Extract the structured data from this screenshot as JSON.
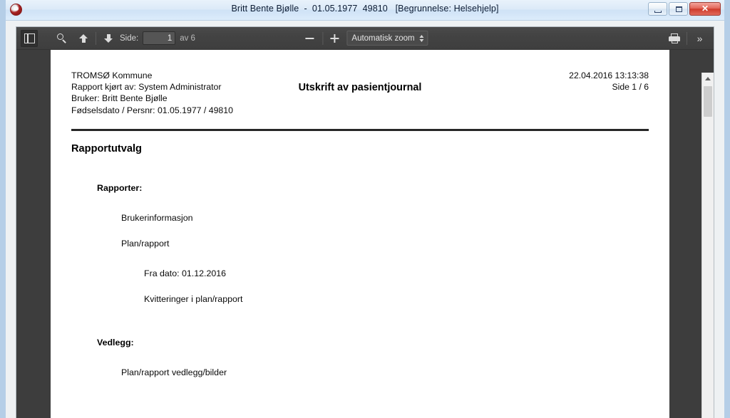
{
  "window": {
    "title": "Britt Bente Bjølle  -  01.05.1977  49810   [Begrunnelse: Helsehjelp]",
    "app_icon": "app-icon",
    "controls": {
      "minimize_label": "",
      "maximize_label": "",
      "close_label": "✕"
    }
  },
  "toolbar": {
    "sidebar_toggle": "toggle-sidebar",
    "find": "search-icon",
    "previous_page": "arrow-up-icon",
    "next_page": "arrow-down-icon",
    "page_label": "Side:",
    "page_value": "1",
    "page_total": "av 6",
    "zoom_out": "−",
    "zoom_in": "+",
    "zoom_value": "Automatisk zoom",
    "print": "printer-icon",
    "more_tools": "»"
  },
  "document": {
    "header_left": [
      "TROMSØ Kommune",
      "Rapport kjørt av: System Administrator",
      "Bruker: Britt Bente Bjølle",
      "Fødselsdato / Persnr: 01.05.1977 / 49810"
    ],
    "header_title": "Utskrift av pasientjournal",
    "header_right": [
      "22.04.2016 13:13:38",
      "Side 1 / 6"
    ],
    "section_title": "Rapportutvalg",
    "groups": [
      {
        "label": "Rapporter:",
        "items": [
          "Brukerinformasjon",
          "Plan/rapport"
        ],
        "subitems": [
          "Fra dato: 01.12.2016",
          "Kvitteringer i plan/rapport"
        ]
      },
      {
        "label": "Vedlegg:",
        "items": [
          "Plan/rapport vedlegg/bilder"
        ],
        "subitems": []
      }
    ]
  },
  "colors": {
    "toolbar_bg": "#424242",
    "viewer_bg": "#3d3d3d",
    "page_bg": "#ffffff",
    "titlebar_accent": "#cfe2f6",
    "close_button": "#cf3a2b"
  }
}
